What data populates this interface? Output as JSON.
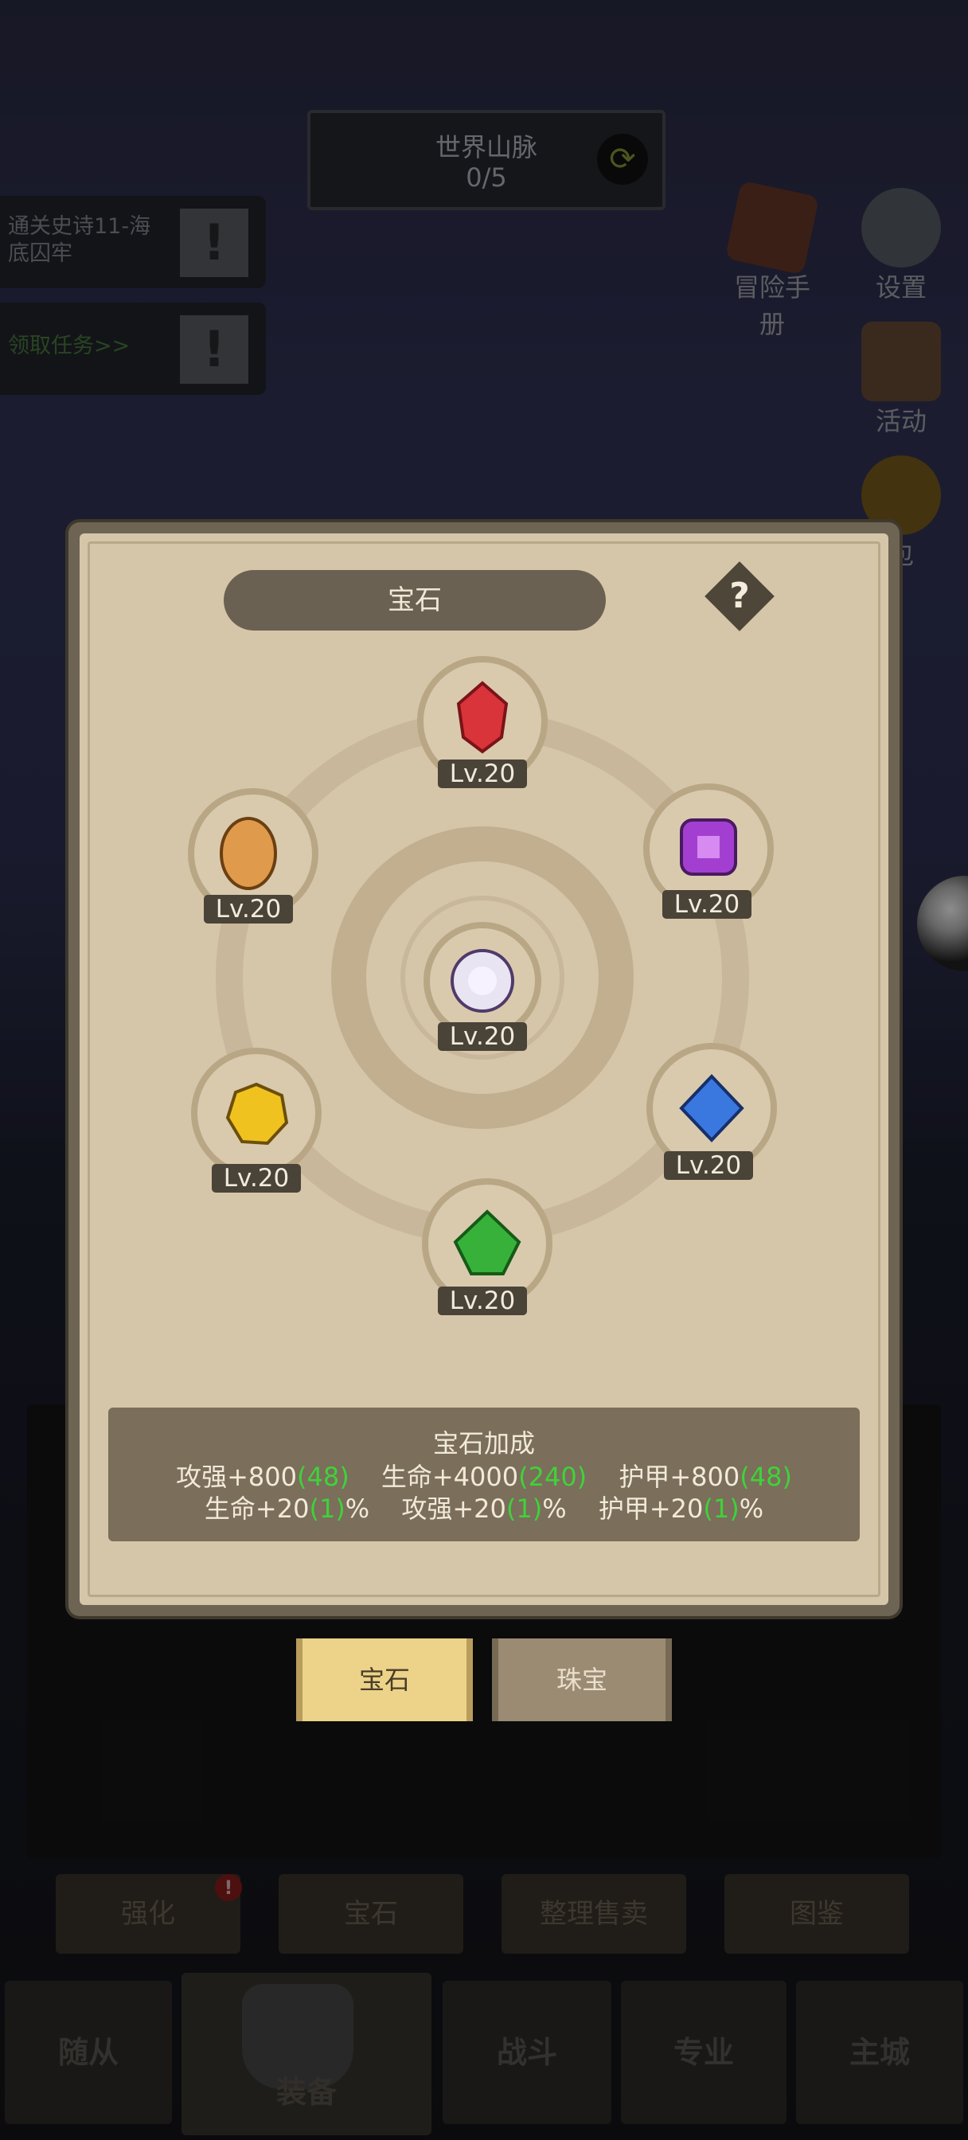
{
  "world": {
    "title": "世界山脉",
    "progress": "0/5"
  },
  "quests": [
    {
      "text": "通关史诗11-海底囚牢",
      "mark": "!"
    },
    {
      "text": "领取任务>>",
      "mark": "!"
    }
  ],
  "side_icons": {
    "manual": "冒险手册",
    "settings": "设置",
    "activity": "活动",
    "bag_partial": "包"
  },
  "modal": {
    "title": "宝石",
    "help": "?",
    "gems": [
      {
        "name": "ruby",
        "level": "Lv.20",
        "color": "#d8343a"
      },
      {
        "name": "amethyst",
        "level": "Lv.20",
        "color": "#a33fd0"
      },
      {
        "name": "sapphire",
        "level": "Lv.20",
        "color": "#3a78e0"
      },
      {
        "name": "emerald",
        "level": "Lv.20",
        "color": "#37b13a"
      },
      {
        "name": "topaz",
        "level": "Lv.20",
        "color": "#f0c21f"
      },
      {
        "name": "amber",
        "level": "Lv.20",
        "color": "#e09a4c"
      },
      {
        "name": "prism",
        "level": "Lv.20",
        "color": "#ffffff"
      }
    ],
    "bonus": {
      "heading": "宝石加成",
      "row1": [
        {
          "label": "攻强+800",
          "extra": "(48)"
        },
        {
          "label": "生命+4000",
          "extra": "(240)"
        },
        {
          "label": "护甲+800",
          "extra": "(48)"
        }
      ],
      "row2": [
        {
          "label": "生命+20",
          "extra": "(1)",
          "unit": "%"
        },
        {
          "label": "攻强+20",
          "extra": "(1)",
          "unit": "%"
        },
        {
          "label": "护甲+20",
          "extra": "(1)",
          "unit": "%"
        }
      ]
    },
    "tabs": {
      "gems": "宝石",
      "jewelry": "珠宝"
    }
  },
  "actions": {
    "enhance": "强化",
    "gems": "宝石",
    "sort_sell": "整理售卖",
    "codex": "图鉴",
    "badge": "!"
  },
  "nav": {
    "followers": "随从",
    "equip": "装备",
    "battle": "战斗",
    "profession": "专业",
    "city": "主城"
  },
  "colors": {
    "parchment": "#d6c6a9",
    "bonus_green": "#3fd23a",
    "active_tab": "#ecd389"
  }
}
